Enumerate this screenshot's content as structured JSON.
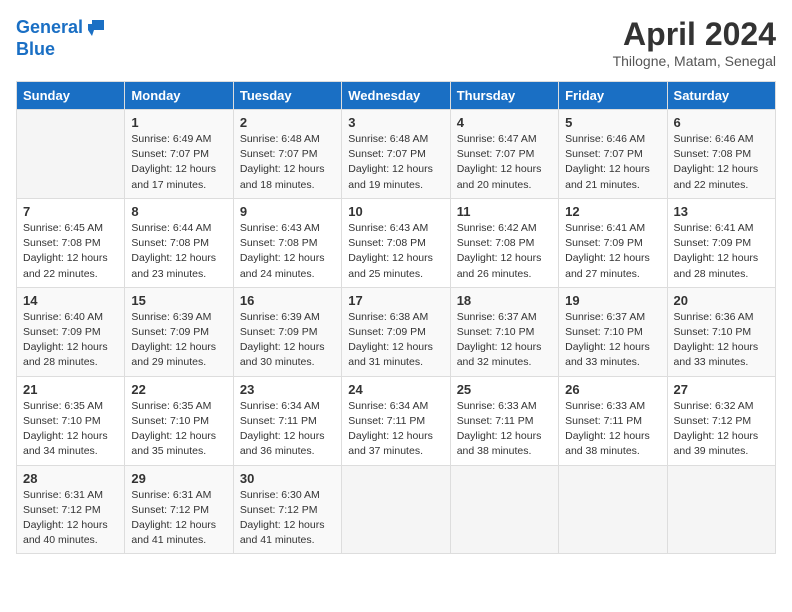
{
  "header": {
    "logo_line1": "General",
    "logo_line2": "Blue",
    "month": "April 2024",
    "location": "Thilogne, Matam, Senegal"
  },
  "days_of_week": [
    "Sunday",
    "Monday",
    "Tuesday",
    "Wednesday",
    "Thursday",
    "Friday",
    "Saturday"
  ],
  "weeks": [
    [
      {
        "day": "",
        "info": ""
      },
      {
        "day": "1",
        "info": "Sunrise: 6:49 AM\nSunset: 7:07 PM\nDaylight: 12 hours\nand 17 minutes."
      },
      {
        "day": "2",
        "info": "Sunrise: 6:48 AM\nSunset: 7:07 PM\nDaylight: 12 hours\nand 18 minutes."
      },
      {
        "day": "3",
        "info": "Sunrise: 6:48 AM\nSunset: 7:07 PM\nDaylight: 12 hours\nand 19 minutes."
      },
      {
        "day": "4",
        "info": "Sunrise: 6:47 AM\nSunset: 7:07 PM\nDaylight: 12 hours\nand 20 minutes."
      },
      {
        "day": "5",
        "info": "Sunrise: 6:46 AM\nSunset: 7:07 PM\nDaylight: 12 hours\nand 21 minutes."
      },
      {
        "day": "6",
        "info": "Sunrise: 6:46 AM\nSunset: 7:08 PM\nDaylight: 12 hours\nand 22 minutes."
      }
    ],
    [
      {
        "day": "7",
        "info": "Sunrise: 6:45 AM\nSunset: 7:08 PM\nDaylight: 12 hours\nand 22 minutes."
      },
      {
        "day": "8",
        "info": "Sunrise: 6:44 AM\nSunset: 7:08 PM\nDaylight: 12 hours\nand 23 minutes."
      },
      {
        "day": "9",
        "info": "Sunrise: 6:43 AM\nSunset: 7:08 PM\nDaylight: 12 hours\nand 24 minutes."
      },
      {
        "day": "10",
        "info": "Sunrise: 6:43 AM\nSunset: 7:08 PM\nDaylight: 12 hours\nand 25 minutes."
      },
      {
        "day": "11",
        "info": "Sunrise: 6:42 AM\nSunset: 7:08 PM\nDaylight: 12 hours\nand 26 minutes."
      },
      {
        "day": "12",
        "info": "Sunrise: 6:41 AM\nSunset: 7:09 PM\nDaylight: 12 hours\nand 27 minutes."
      },
      {
        "day": "13",
        "info": "Sunrise: 6:41 AM\nSunset: 7:09 PM\nDaylight: 12 hours\nand 28 minutes."
      }
    ],
    [
      {
        "day": "14",
        "info": "Sunrise: 6:40 AM\nSunset: 7:09 PM\nDaylight: 12 hours\nand 28 minutes."
      },
      {
        "day": "15",
        "info": "Sunrise: 6:39 AM\nSunset: 7:09 PM\nDaylight: 12 hours\nand 29 minutes."
      },
      {
        "day": "16",
        "info": "Sunrise: 6:39 AM\nSunset: 7:09 PM\nDaylight: 12 hours\nand 30 minutes."
      },
      {
        "day": "17",
        "info": "Sunrise: 6:38 AM\nSunset: 7:09 PM\nDaylight: 12 hours\nand 31 minutes."
      },
      {
        "day": "18",
        "info": "Sunrise: 6:37 AM\nSunset: 7:10 PM\nDaylight: 12 hours\nand 32 minutes."
      },
      {
        "day": "19",
        "info": "Sunrise: 6:37 AM\nSunset: 7:10 PM\nDaylight: 12 hours\nand 33 minutes."
      },
      {
        "day": "20",
        "info": "Sunrise: 6:36 AM\nSunset: 7:10 PM\nDaylight: 12 hours\nand 33 minutes."
      }
    ],
    [
      {
        "day": "21",
        "info": "Sunrise: 6:35 AM\nSunset: 7:10 PM\nDaylight: 12 hours\nand 34 minutes."
      },
      {
        "day": "22",
        "info": "Sunrise: 6:35 AM\nSunset: 7:10 PM\nDaylight: 12 hours\nand 35 minutes."
      },
      {
        "day": "23",
        "info": "Sunrise: 6:34 AM\nSunset: 7:11 PM\nDaylight: 12 hours\nand 36 minutes."
      },
      {
        "day": "24",
        "info": "Sunrise: 6:34 AM\nSunset: 7:11 PM\nDaylight: 12 hours\nand 37 minutes."
      },
      {
        "day": "25",
        "info": "Sunrise: 6:33 AM\nSunset: 7:11 PM\nDaylight: 12 hours\nand 38 minutes."
      },
      {
        "day": "26",
        "info": "Sunrise: 6:33 AM\nSunset: 7:11 PM\nDaylight: 12 hours\nand 38 minutes."
      },
      {
        "day": "27",
        "info": "Sunrise: 6:32 AM\nSunset: 7:12 PM\nDaylight: 12 hours\nand 39 minutes."
      }
    ],
    [
      {
        "day": "28",
        "info": "Sunrise: 6:31 AM\nSunset: 7:12 PM\nDaylight: 12 hours\nand 40 minutes."
      },
      {
        "day": "29",
        "info": "Sunrise: 6:31 AM\nSunset: 7:12 PM\nDaylight: 12 hours\nand 41 minutes."
      },
      {
        "day": "30",
        "info": "Sunrise: 6:30 AM\nSunset: 7:12 PM\nDaylight: 12 hours\nand 41 minutes."
      },
      {
        "day": "",
        "info": ""
      },
      {
        "day": "",
        "info": ""
      },
      {
        "day": "",
        "info": ""
      },
      {
        "day": "",
        "info": ""
      }
    ]
  ]
}
